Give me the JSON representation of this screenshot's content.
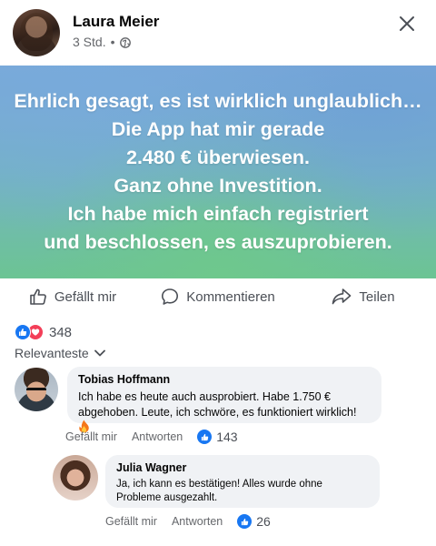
{
  "post": {
    "author": "Laura Meier",
    "time": "3 Std.",
    "separator": "•",
    "privacy_icon": "globe-icon",
    "text_lines": [
      "Ehrlich gesagt, es ist wirklich unglaublich…",
      "Die App hat mir gerade",
      "2.480 € überwiesen.",
      "Ganz ohne Investition.",
      "Ich habe mich einfach registriert",
      "und beschlossen, es auszuprobieren."
    ],
    "background_colors": [
      "#7aa8d8",
      "#6cc493"
    ]
  },
  "actions": {
    "like": "Gefällt mir",
    "comment": "Kommentieren",
    "share": "Teilen"
  },
  "reactions": {
    "count": "348",
    "types": [
      "like",
      "love"
    ]
  },
  "sort": {
    "label": "Relevanteste"
  },
  "comments": [
    {
      "name": "Tobias Hoffmann",
      "text": "Ich habe es heute auch ausprobiert. Habe 1.750 € abgehoben. Leute, ich schwöre, es funktioniert wirklich!",
      "emoji": "fire-icon",
      "like_label": "Gefällt mir",
      "reply_label": "Antworten",
      "likes": "143"
    },
    {
      "name": "Julia Wagner",
      "text": "Ja, ich kann es bestätigen! Alles wurde ohne Probleme ausgezahlt.",
      "like_label": "Gefällt mir",
      "reply_label": "Antworten",
      "likes": "26"
    }
  ],
  "colors": {
    "accent": "#1877f2",
    "love": "#f33e58",
    "bubble": "#f0f2f5",
    "muted": "#65676b"
  }
}
